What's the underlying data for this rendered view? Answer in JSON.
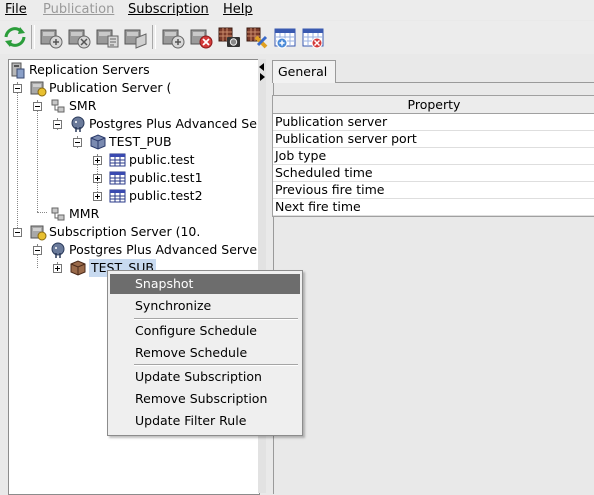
{
  "menubar": {
    "items": [
      {
        "label": "File",
        "enabled": true
      },
      {
        "label": "Publication",
        "enabled": false
      },
      {
        "label": "Subscription",
        "enabled": true
      },
      {
        "label": "Help",
        "enabled": true
      }
    ]
  },
  "toolbar": {
    "buttons": [
      "refresh-icon",
      "create-publication-icon",
      "remove-publication-icon",
      "publication-properties-icon",
      "publication-server-icon",
      "create-subscription-icon",
      "remove-subscription-icon",
      "snapshot-icon",
      "synchronize-icon",
      "configure-schedule-icon",
      "remove-schedule-icon"
    ]
  },
  "tree": {
    "root": "Replication Servers",
    "publication_server": "Publication Server (",
    "smr": "SMR",
    "pub_db": "Postgres Plus Advanced Se",
    "test_pub": "TEST_PUB",
    "tables": [
      "public.test",
      "public.test1",
      "public.test2"
    ],
    "mmr": "MMR",
    "subscription_server": "Subscription Server (10.",
    "sub_db": "Postgres Plus Advanced Serve",
    "test_sub": "TEST_SUB"
  },
  "tabs": {
    "general": "General"
  },
  "property_table": {
    "header": "Property",
    "rows": [
      "Publication server",
      "Publication server port",
      "Job type",
      "Scheduled time",
      "Previous fire time",
      "Next fire time"
    ]
  },
  "context_menu": {
    "items": [
      {
        "label": "Snapshot",
        "selected": true
      },
      {
        "label": "Synchronize"
      },
      {
        "label": "Configure Schedule"
      },
      {
        "label": "Remove Schedule"
      },
      {
        "label": "Update Subscription"
      },
      {
        "label": "Remove Subscription"
      },
      {
        "label": "Update Filter Rule"
      }
    ]
  },
  "colors": {
    "menu_highlight": "#6d6d6d",
    "tree_selection": "#c8daf0",
    "window_bg": "#e9e9e9"
  }
}
